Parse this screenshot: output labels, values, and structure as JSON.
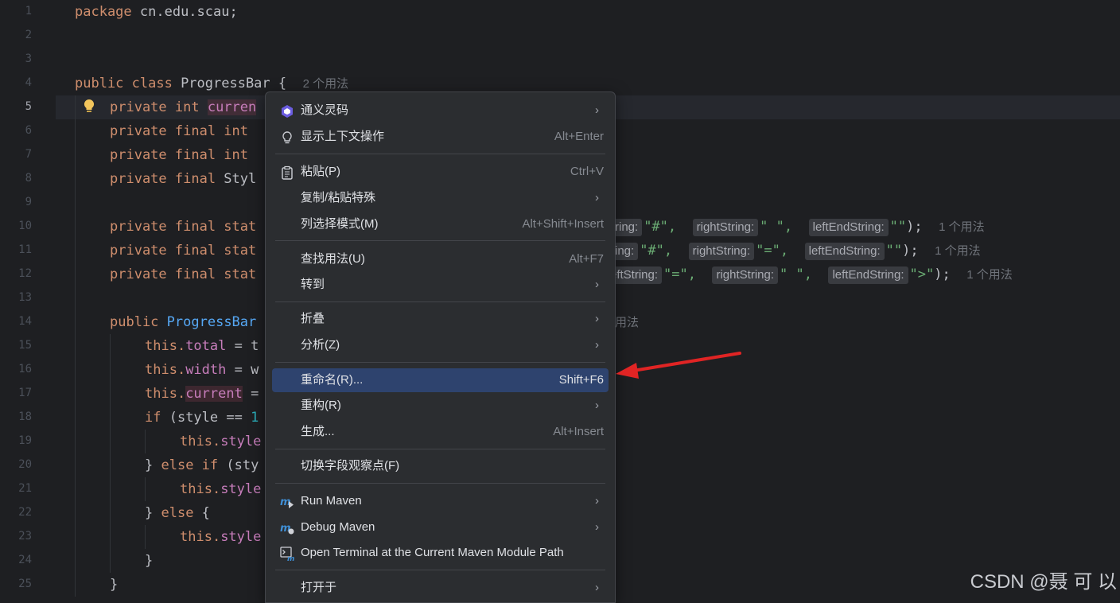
{
  "line_numbers": [
    "1",
    "2",
    "3",
    "4",
    "5",
    "6",
    "7",
    "8",
    "9",
    "10",
    "11",
    "12",
    "13",
    "14",
    "15",
    "16",
    "17",
    "18",
    "19",
    "20",
    "21",
    "22",
    "23",
    "24",
    "25"
  ],
  "code": {
    "l1": {
      "kw": "package",
      "rest": " cn.edu.scau;"
    },
    "l4": {
      "kw": "public class",
      "rest": " ProgressBar {",
      "hint": "2 个用法"
    },
    "l5": {
      "kw": "private int",
      "field": "curren"
    },
    "l6": {
      "kw": "private final int"
    },
    "l7": {
      "kw": "private final int"
    },
    "l8": {
      "kw": "private final",
      "rest": " Styl"
    },
    "l10": {
      "kw": "private final stat",
      "p1": "ring:",
      "v1": "\"#\",",
      "p2": "rightString:",
      "v2": "\" \",",
      "p3": "leftEndString:",
      "v3": "\"\"",
      "end": ");",
      "hint": "1 个用法"
    },
    "l11": {
      "kw": "private final stat",
      "p1": "ing:",
      "v1": "\"#\",",
      "p2": "rightString:",
      "v2": "\"=\",",
      "p3": "leftEndString:",
      "v3": "\"\"",
      "end": ");",
      "hint": "1 个用法"
    },
    "l12": {
      "kw": "private final stat",
      "p1": "eftString:",
      "v1": "\"=\",",
      "p2": "rightString:",
      "v2": "\" \",",
      "p3": "leftEndString:",
      "v3": "\">\"",
      "end": ");",
      "hint": "1 个用法"
    },
    "l14": {
      "kw": "public",
      "method": "ProgressBar",
      "hint": "用法"
    },
    "l15": {
      "this": "this.",
      "field": "total",
      "rest": " = t"
    },
    "l16": {
      "this": "this.",
      "field": "width",
      "rest": " = w"
    },
    "l17": {
      "this": "this.",
      "field": "current",
      "rest": " ="
    },
    "l18": {
      "kw": "if",
      "rest": " (style == ",
      "num": "1"
    },
    "l19": {
      "this": "this.",
      "field": "style"
    },
    "l20": {
      "rest1": "} ",
      "kw": "else if",
      "rest": " (sty"
    },
    "l21": {
      "this": "this.",
      "field": "style"
    },
    "l22": {
      "rest1": "} ",
      "kw": "else",
      "rest": " {"
    },
    "l23": {
      "this": "this.",
      "field": "style"
    },
    "l24": {
      "rest": "}"
    },
    "l25": {
      "rest": "}"
    }
  },
  "menu": {
    "items": [
      {
        "label": "通义灵码",
        "shortcut": "",
        "icon": "tongyi-icon",
        "submenu": true
      },
      {
        "label": "显示上下文操作",
        "shortcut": "Alt+Enter",
        "icon": "lightbulb-icon",
        "submenu": false
      },
      {
        "label": "粘贴(P)",
        "shortcut": "Ctrl+V",
        "icon": "clipboard-icon",
        "submenu": false
      },
      {
        "label": "复制/粘贴特殊",
        "shortcut": "",
        "icon": "",
        "submenu": true
      },
      {
        "label": "列选择模式(M)",
        "shortcut": "Alt+Shift+Insert",
        "icon": "",
        "submenu": false
      },
      {
        "label": "查找用法(U)",
        "shortcut": "Alt+F7",
        "icon": "",
        "submenu": false
      },
      {
        "label": "转到",
        "shortcut": "",
        "icon": "",
        "submenu": true
      },
      {
        "label": "折叠",
        "shortcut": "",
        "icon": "",
        "submenu": true
      },
      {
        "label": "分析(Z)",
        "shortcut": "",
        "icon": "",
        "submenu": true
      },
      {
        "label": "重命名(R)...",
        "shortcut": "Shift+F6",
        "icon": "",
        "submenu": false,
        "selected": true
      },
      {
        "label": "重构(R)",
        "shortcut": "",
        "icon": "",
        "submenu": true
      },
      {
        "label": "生成...",
        "shortcut": "Alt+Insert",
        "icon": "",
        "submenu": false
      },
      {
        "label": "切换字段观察点(F)",
        "shortcut": "",
        "icon": "",
        "submenu": false
      },
      {
        "label": "Run Maven",
        "shortcut": "",
        "icon": "maven-run-icon",
        "submenu": true
      },
      {
        "label": "Debug Maven",
        "shortcut": "",
        "icon": "maven-debug-icon",
        "submenu": true
      },
      {
        "label": "Open Terminal at the Current Maven Module Path",
        "shortcut": "",
        "icon": "terminal-icon",
        "submenu": false
      },
      {
        "label": "打开于",
        "shortcut": "",
        "icon": "",
        "submenu": true
      }
    ],
    "arrow_glyph": "›"
  },
  "colors": {
    "selection": "#2e436e",
    "annotation_arrow": "#e02424"
  },
  "watermark": "CSDN @聂 可 以"
}
